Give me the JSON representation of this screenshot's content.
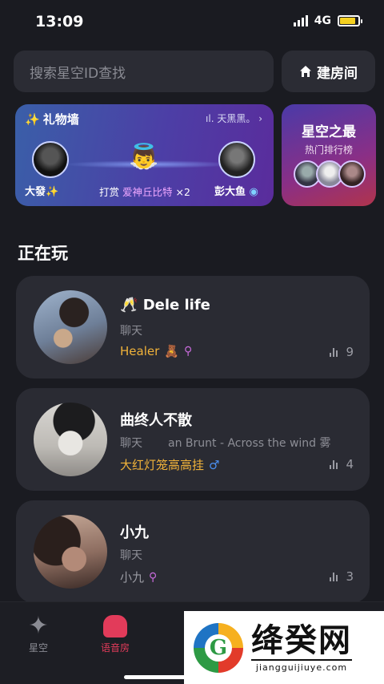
{
  "status_bar": {
    "time": "13:09",
    "network": "4G",
    "battery_level": 0.85,
    "battery_color": "#f5d020"
  },
  "search": {
    "placeholder": "搜索星空ID查找"
  },
  "create_room": {
    "label": "建房间",
    "icon": "home-icon"
  },
  "gift_wall": {
    "title": "礼物墙",
    "title_icon": "sparkle-icon",
    "top_right": "天黑黑。",
    "sender": "大發✨",
    "action": "打赏",
    "gift_name": "爱神丘比特",
    "gift_count": "×2",
    "receiver": "彭大鱼"
  },
  "ranking": {
    "title": "星空之最",
    "subtitle": "热门排行榜"
  },
  "section_title": "正在玩",
  "rooms": [
    {
      "name": "Dele life",
      "name_icon": "champagne-icon",
      "type": "聊天",
      "song": "",
      "host": "Healer",
      "host_icon": "bear-icon",
      "host_gender": "female",
      "count": "9"
    },
    {
      "name": "曲终人不散",
      "type": "聊天",
      "song": "an Brunt - Across the wind  雾",
      "host": "大红灯笼高高挂",
      "host_gender": "male",
      "count": "4"
    },
    {
      "name": "小九",
      "type": "聊天",
      "song": "",
      "host": "小九",
      "host_gender": "female",
      "count": "3"
    }
  ],
  "tabbar": [
    {
      "label": "星空",
      "icon": "sparkle-icon"
    },
    {
      "label": "语音房",
      "icon": "voice-room-icon",
      "active": true
    }
  ],
  "watermark": {
    "title": "绛癸网",
    "url": "jiangguijiuye.com"
  },
  "colors": {
    "background": "#1a1b21",
    "card": "#2a2b33",
    "accent": "#e23b5a",
    "gold": "#f0b23a"
  }
}
